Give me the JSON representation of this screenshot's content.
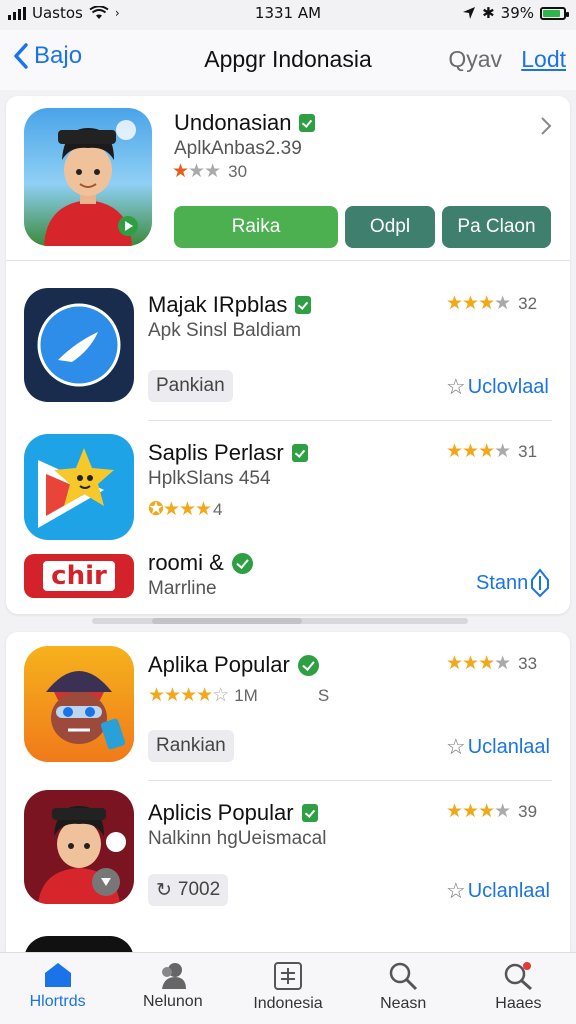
{
  "status_bar": {
    "carrier": "Uastos",
    "time": "1331 AM",
    "battery": "39%"
  },
  "nav": {
    "back_label": "Bajo",
    "title": "Appgr Indonasia",
    "right1": "Qyav",
    "right2": "Lodt"
  },
  "featured": {
    "name": "Undonasian",
    "subtitle": "AplkAnbas2.39",
    "rating_count": "30",
    "buttons": [
      "Raika",
      "Odpl",
      "Pa Claon"
    ]
  },
  "list1": [
    {
      "name": "Majak IRpblas",
      "subtitle": "Apk Sinsl Baldiam",
      "rating": "32",
      "chip": "Pankian",
      "download": "Uclovlaal"
    },
    {
      "name": "Saplis Perlasr",
      "subtitle": "HplkSlans 454",
      "rating": "31",
      "sub_rating": "4"
    },
    {
      "name": "roomi &",
      "subtitle": "Marrline",
      "logo_text": "chir",
      "action": "Stann"
    }
  ],
  "list2": [
    {
      "name": "Aplika Popular",
      "sub_count": "1M",
      "sub_extra": "S",
      "rating": "33",
      "chip": "Rankian",
      "download": "Uclanlaal"
    },
    {
      "name": "Aplicis Popular",
      "subtitle": "Nalkinn hgUeismacal",
      "rating": "39",
      "chip": "7002",
      "download": "Uclanlaal"
    }
  ],
  "tabs": [
    "Hlortrds",
    "Nelunon",
    "Indonesia",
    "Neasn",
    "Haaes"
  ],
  "colors": {
    "accent": "#1a73e8",
    "green": "#4caf50",
    "teal": "#3f7f6d",
    "star": "#f0a91b"
  }
}
